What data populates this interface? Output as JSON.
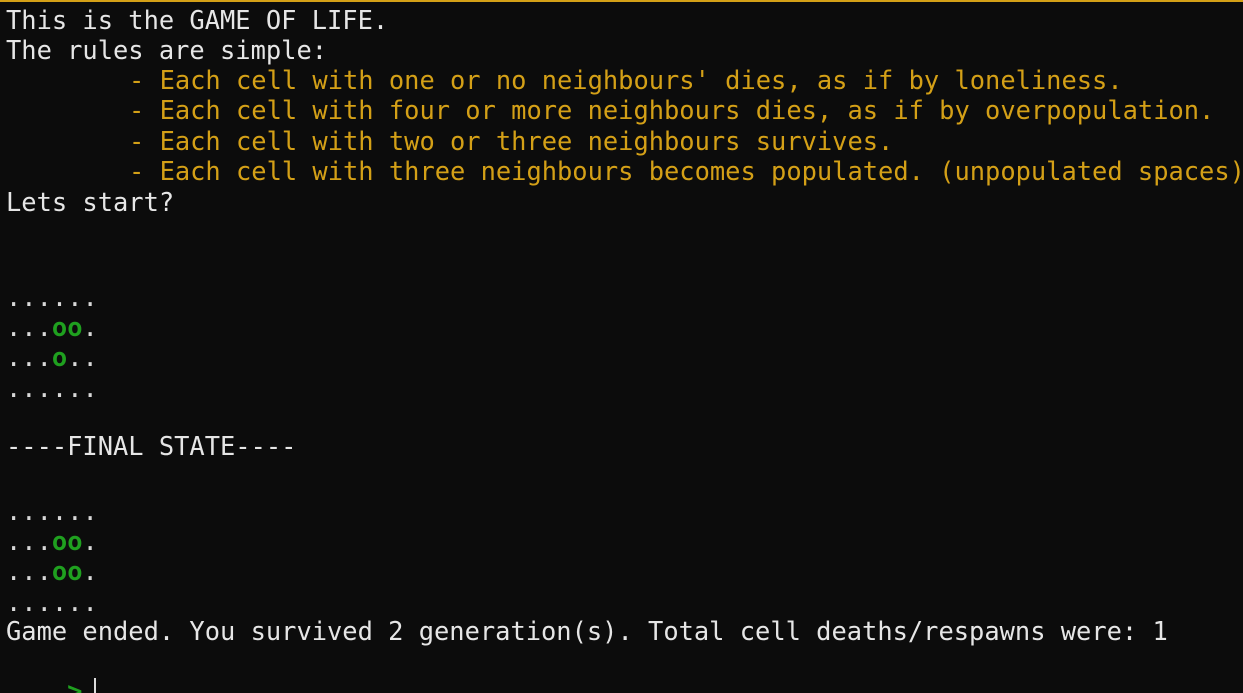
{
  "intro": {
    "title": "This is the GAME OF LIFE.",
    "rules_heading": "The rules are simple:",
    "rules": [
      "- Each cell with one or no neighbours' dies, as if by loneliness.",
      "- Each cell with four or more neighbours dies, as if by overpopulation.",
      "- Each cell with two or three neighbours survives.",
      "- Each cell with three neighbours becomes populated. (unpopulated spaces)"
    ],
    "start_prompt": "Lets start?"
  },
  "initial_grid": {
    "rows": [
      "......",
      "...oo.",
      "...o..",
      "......"
    ]
  },
  "final_state_label": "----FINAL STATE----",
  "final_grid": {
    "rows": [
      "......",
      "...oo.",
      "...oo.",
      "......"
    ]
  },
  "result_text": "Game ended. You survived 2 generation(s). Total cell deaths/respawns were: 1",
  "prompt": {
    "symbol": ">"
  },
  "colors": {
    "rules_text": "#d4a017",
    "live_cell": "#1fa01f",
    "background": "#0c0c0c",
    "default_text": "#e6e6e6"
  }
}
